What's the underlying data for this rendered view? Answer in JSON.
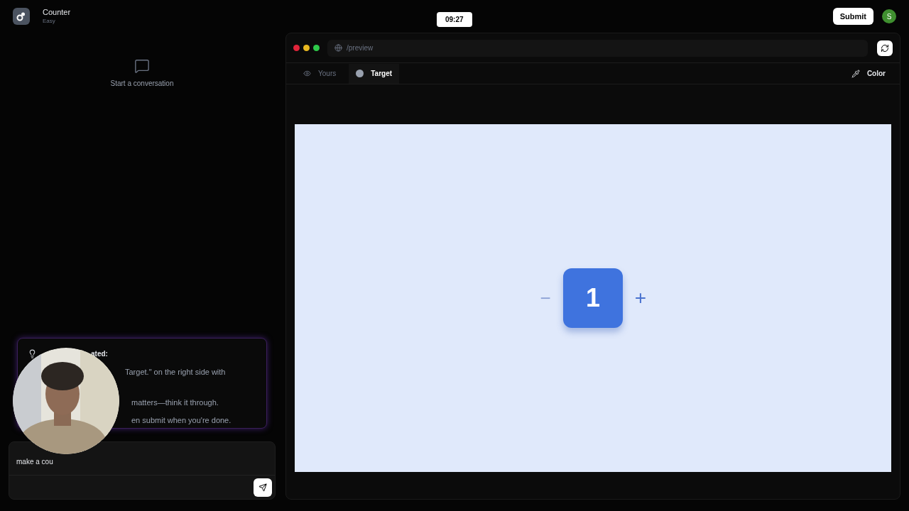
{
  "header": {
    "title": "Counter",
    "difficulty": "Easy",
    "timer": "09:27",
    "submit": "Submit",
    "avatar": "S"
  },
  "chat": {
    "empty_label": "Start a conversation",
    "hint": {
      "heading": "ated:",
      "lines": [
        "Target.\" on the right side with",
        "matters—think it through.",
        "en submit when you're done."
      ]
    },
    "input": {
      "value": "make a cou"
    }
  },
  "preview": {
    "url": "/preview",
    "tabs": [
      {
        "label": "Yours",
        "selected": false
      },
      {
        "label": "Target",
        "selected": true
      }
    ],
    "color_button": "Color",
    "counter": {
      "minus": "−",
      "value": "1",
      "plus": "+"
    }
  }
}
